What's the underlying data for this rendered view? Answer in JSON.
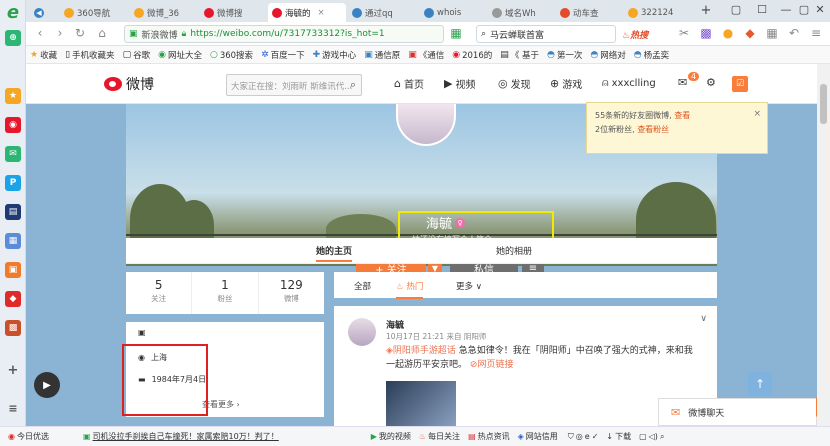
{
  "browser": {
    "tabs": [
      {
        "label": "360导航",
        "color": "#f5a623"
      },
      {
        "label": "微博_36",
        "color": "#f5a623"
      },
      {
        "label": "微博搜",
        "color": "#e6162d"
      },
      {
        "label": "海毓的",
        "color": "#e6162d"
      },
      {
        "label": "通过qq",
        "color": "#3b82c4"
      },
      {
        "label": "whois",
        "color": "#3b82c4"
      },
      {
        "label": "域名Wh",
        "color": "#999999"
      },
      {
        "label": "动车查",
        "color": "#e34b2a"
      },
      {
        "label": "322124",
        "color": "#f5a623"
      }
    ],
    "tab_close": "×",
    "new_tab": "+",
    "win_controls": [
      "▢",
      "☐",
      "—",
      "▢",
      "✕"
    ],
    "url_label": "新浪微博",
    "url": "https://weibo.com/u/7317733312?is_hot=1",
    "search_text": "马云蝉联首富",
    "search_hot": "热搜",
    "bookmarks": [
      "收藏",
      "手机收藏夹",
      "谷歌",
      "网址大全",
      "360搜索",
      "百度一下",
      "游戏中心",
      "通信原",
      "《通信",
      "2016的",
      "《 基于",
      "第一次",
      "网络对",
      "杨孟奕"
    ]
  },
  "weibo": {
    "logo_text": "微博",
    "search_placeholder": "大家正在搜：刘雨昕 斯维讯代...",
    "nav": [
      {
        "label": "首页",
        "icon": "home"
      },
      {
        "label": "视频",
        "icon": "video"
      },
      {
        "label": "发现",
        "icon": "compass"
      },
      {
        "label": "游戏",
        "icon": "gamepad"
      },
      {
        "label": "xxxclling",
        "icon": "user"
      }
    ],
    "msg_badge": "4",
    "write_label": "☑",
    "notif_line1": "55条新的好友圈微博,",
    "notif_link1": "查看",
    "notif_line2": "2位新粉丝,",
    "notif_link2": "查看粉丝",
    "profile_name": "海毓",
    "profile_intro": "她还没有填写个人简介",
    "follow_btn": "+ 关注",
    "msg_btn": "私信",
    "tabs": [
      "她的主页",
      "她的相册"
    ],
    "stats": [
      {
        "num": "5",
        "label": "关注"
      },
      {
        "num": "1",
        "label": "粉丝"
      },
      {
        "num": "129",
        "label": "微博"
      }
    ],
    "info_location": "上海",
    "info_birthday": "1984年7月4日",
    "info_more": "查看更多 ›",
    "feed_tabs": [
      "全部",
      "热门",
      "更多 ∨"
    ],
    "post": {
      "name": "海毓",
      "meta": "10月17日 21:21 来自 阴阳师",
      "tag": "阴阳师手游超话",
      "text": " 急急如律令！我在「阴阳师」中召唤了强大的式神，来和我一起游历平安京吧。",
      "link": "网页链接"
    },
    "chat_label": "微博聊天"
  },
  "statusbar": {
    "left": "今日优选",
    "news": "司机没拉手刹挨自己车撞死！家属索赔10万！判了！",
    "items": [
      "我的视频",
      "每日关注",
      "热点资讯",
      "网站信用",
      "下载"
    ]
  }
}
